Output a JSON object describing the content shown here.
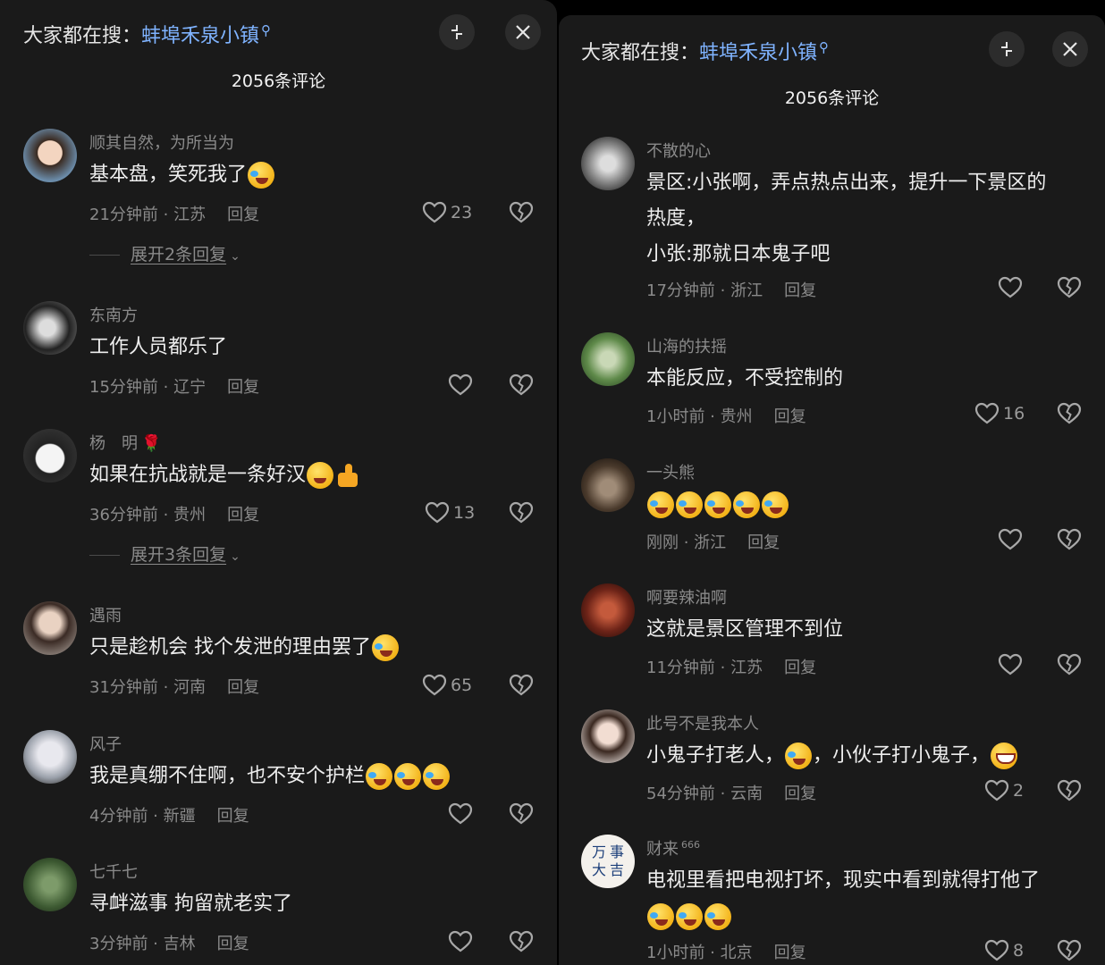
{
  "left": {
    "search_prefix": "大家都在搜：",
    "search_keyword": "蚌埠禾泉小镇",
    "count_title": "2056条评论",
    "comments": [
      {
        "user": "顺其自然，为所当为",
        "text": "基本盘，笑死我了",
        "meta": "21分钟前 · 江苏",
        "reply": "回复",
        "likes": "23",
        "expand": "展开2条回复"
      },
      {
        "user": "东南方",
        "text": "工作人员都乐了",
        "meta": "15分钟前 · 辽宁",
        "reply": "回复",
        "likes": ""
      },
      {
        "user": "杨　明",
        "text": "如果在抗战就是一条好汉",
        "meta": "36分钟前 · 贵州",
        "reply": "回复",
        "likes": "13",
        "expand": "展开3条回复"
      },
      {
        "user": "遇雨",
        "text": "只是趁机会 找个发泄的理由罢了",
        "meta": "31分钟前 · 河南",
        "reply": "回复",
        "likes": "65"
      },
      {
        "user": "风子",
        "text": "我是真绷不住啊，也不安个护栏",
        "meta": "4分钟前 · 新疆",
        "reply": "回复",
        "likes": ""
      },
      {
        "user": "七千七",
        "text": "寻衅滋事 拘留就老实了",
        "meta": "3分钟前 · 吉林",
        "reply": "回复",
        "likes": ""
      }
    ]
  },
  "right": {
    "search_prefix": "大家都在搜：",
    "search_keyword": "蚌埠禾泉小镇",
    "count_title": "2056条评论",
    "comments": [
      {
        "user": "不散的心",
        "text_1": "景区:小张啊，弄点热点出来，提升一下景区的",
        "text_2": "热度，",
        "text_3": "小张:那就日本鬼子吧",
        "meta": "17分钟前 · 浙江",
        "reply": "回复",
        "likes": ""
      },
      {
        "user": "山海的扶摇",
        "text": "本能反应，不受控制的",
        "meta": "1小时前 · 贵州",
        "reply": "回复",
        "likes": "16"
      },
      {
        "user": "一头熊",
        "text": "",
        "meta": "刚刚 · 浙江",
        "reply": "回复",
        "likes": ""
      },
      {
        "user": "啊要辣油啊",
        "text": "这就是景区管理不到位",
        "meta": "11分钟前 · 江苏",
        "reply": "回复",
        "likes": ""
      },
      {
        "user": "此号不是我本人",
        "text_a": "小鬼子打老人，",
        "text_b": "，小伙子打小鬼子，",
        "meta": "54分钟前 · 云南",
        "reply": "回复",
        "likes": "2"
      },
      {
        "user": "财来",
        "user_sup": "666",
        "text": "电视里看把电视打坏，现实中看到就得打他了",
        "meta": "1小时前 · 北京",
        "reply": "回复",
        "likes": "8",
        "avatar_chars": [
          "万",
          "事",
          "大",
          "吉"
        ]
      }
    ]
  },
  "icons": {
    "search": "search-icon",
    "collapse": "collapse-icon",
    "close": "close-icon",
    "like": "heart-icon",
    "dislike": "broken-heart-icon"
  },
  "colors": {
    "background": "#1a1a1a",
    "keyword": "#7fb3ff",
    "secondary_text": "#8a8a8a"
  }
}
